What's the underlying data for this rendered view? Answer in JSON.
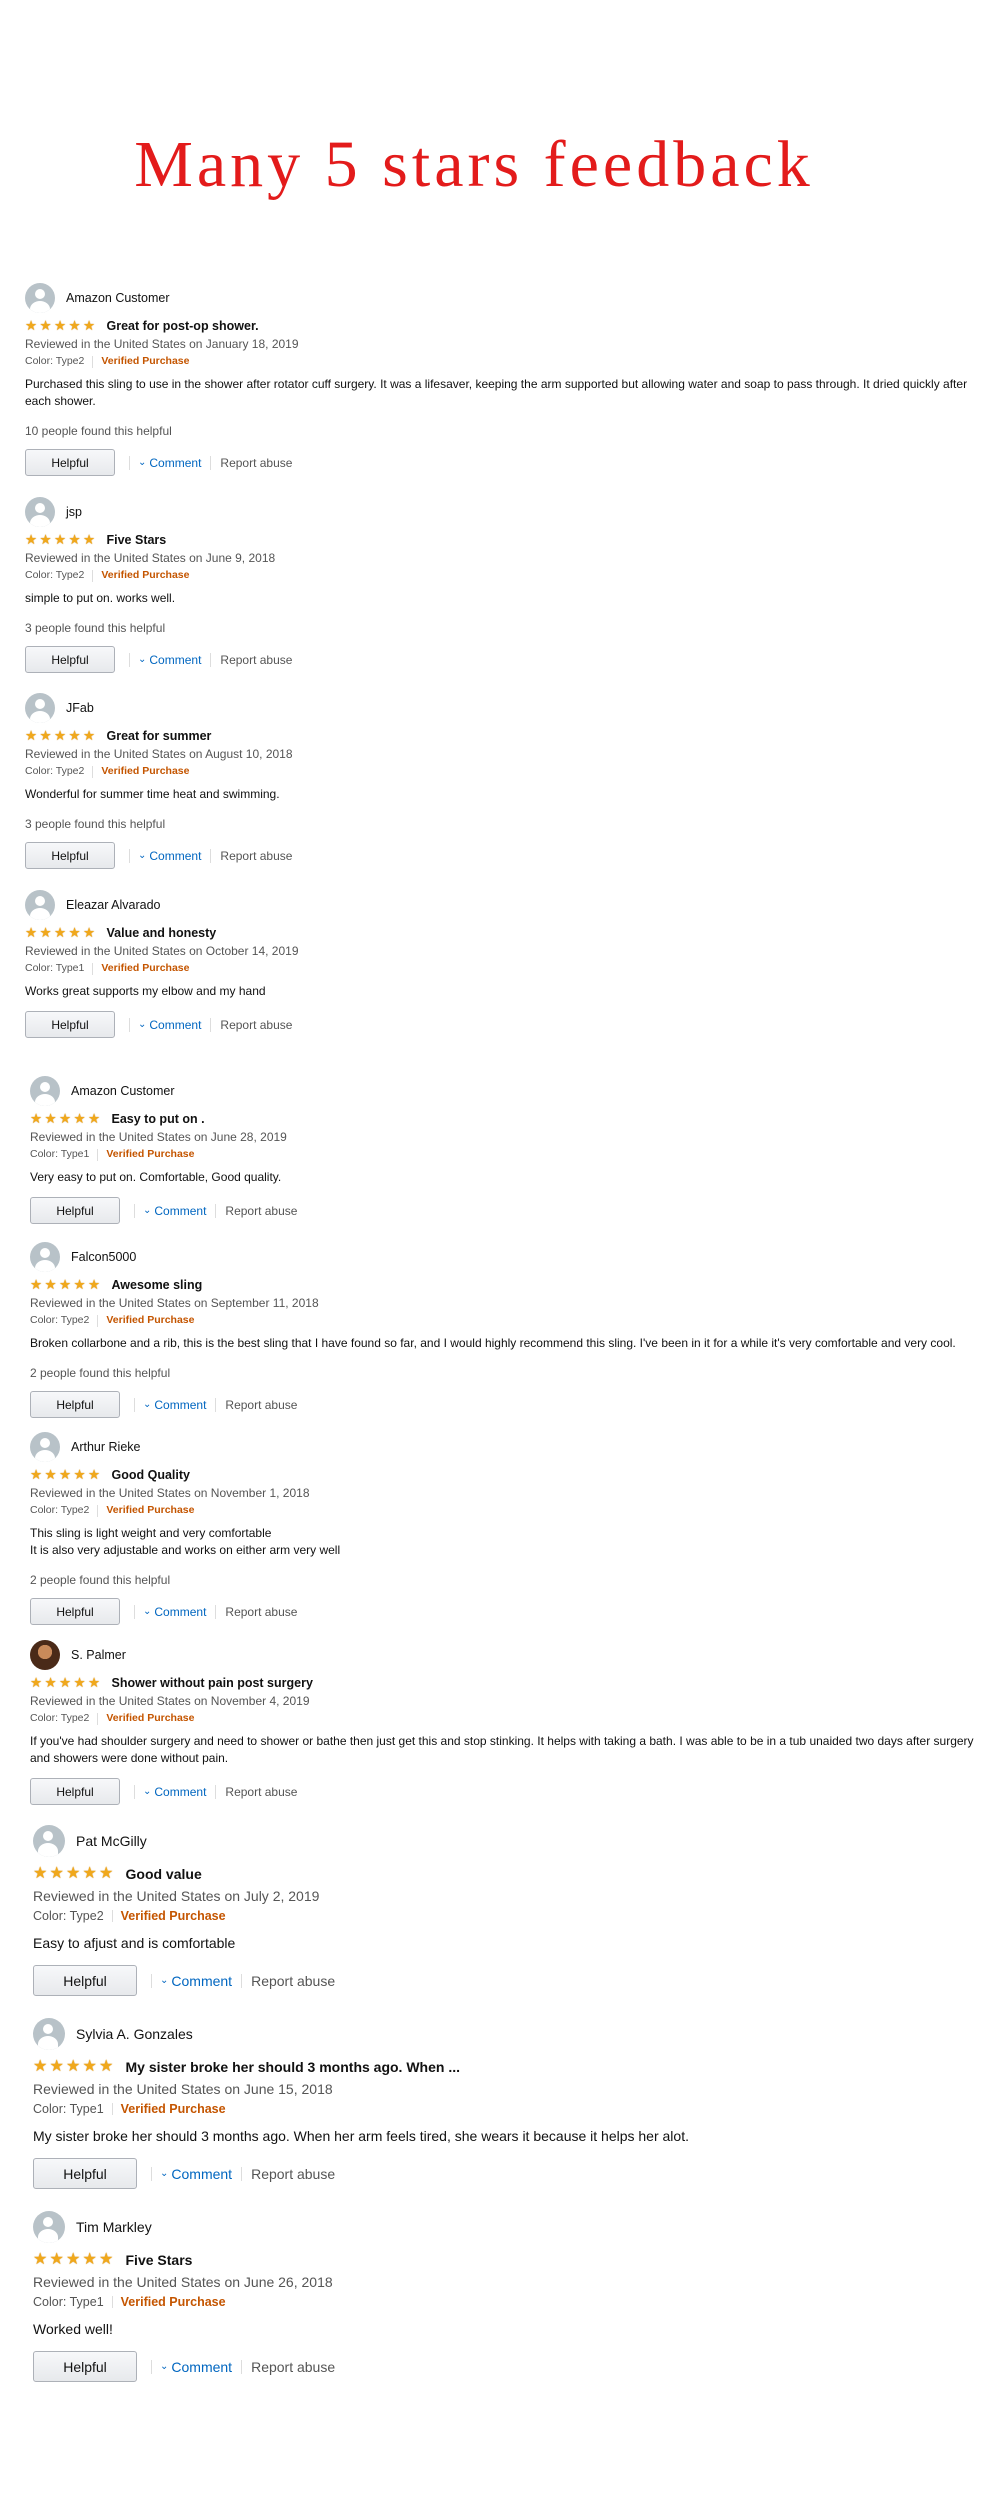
{
  "banner": "Many 5 stars feedback",
  "labels": {
    "verified": "Verified Purchase",
    "helpful_button": "Helpful",
    "comment": "Comment",
    "report": "Report abuse"
  },
  "reviews": [
    {
      "name": "Amazon Customer",
      "rating": 5,
      "title": "Great for post-op shower.",
      "date": "Reviewed in the United States on January 18, 2019",
      "color": "Color: Type2",
      "body": [
        "Purchased this sling to use in the shower after rotator cuff surgery. It was a lifesaver, keeping the arm supported but allowing water and soap to pass through. It dried quickly after each shower."
      ],
      "helpful": "10 people found this helpful",
      "avatar": "default"
    },
    {
      "name": "jsp",
      "rating": 5,
      "title": "Five Stars",
      "date": "Reviewed in the United States on June 9, 2018",
      "color": "Color: Type2",
      "body": [
        "simple to put on. works well."
      ],
      "helpful": "3 people found this helpful",
      "avatar": "default"
    },
    {
      "name": "JFab",
      "rating": 5,
      "title": "Great for summer",
      "date": "Reviewed in the United States on August 10, 2018",
      "color": "Color: Type2",
      "body": [
        "Wonderful for summer time heat and swimming."
      ],
      "helpful": "3 people found this helpful",
      "avatar": "default"
    },
    {
      "name": "Eleazar Alvarado",
      "rating": 5,
      "title": "Value and honesty",
      "date": "Reviewed in the United States on October 14, 2019",
      "color": "Color: Type1",
      "body": [
        "Works great supports my elbow and my hand"
      ],
      "helpful": "",
      "avatar": "default"
    },
    {
      "name": "Amazon Customer",
      "rating": 5,
      "title": "Easy to put on .",
      "date": "Reviewed in the United States on June 28, 2019",
      "color": "Color: Type1",
      "body": [
        "Very easy to put on. Comfortable, Good quality."
      ],
      "helpful": "",
      "avatar": "default"
    },
    {
      "name": "Falcon5000",
      "rating": 5,
      "title": "Awesome sling",
      "date": "Reviewed in the United States on September 11, 2018",
      "color": "Color: Type2",
      "body": [
        "Broken collarbone and a rib, this is the best sling that I have found so far, and I would highly recommend this sling. I've been in it for a while it's very comfortable and very cool."
      ],
      "helpful": "2 people found this helpful",
      "avatar": "default"
    },
    {
      "name": "Arthur Rieke",
      "rating": 5,
      "title": "Good Quality",
      "date": "Reviewed in the United States on November 1, 2018",
      "color": "Color: Type2",
      "body": [
        "This sling is light weight and very comfortable",
        "It is also very adjustable and works on either arm very well"
      ],
      "helpful": "2 people found this helpful",
      "avatar": "default"
    },
    {
      "name": "S. Palmer",
      "rating": 5,
      "title": "Shower without pain post surgery",
      "date": "Reviewed in the United States on November 4, 2019",
      "color": "Color: Type2",
      "body": [
        "If you've had shoulder surgery and need to shower or bathe then just get this and stop stinking. It helps with taking a bath. I was able to be in a tub unaided two days after surgery and showers were done without pain."
      ],
      "helpful": "",
      "avatar": "photo"
    },
    {
      "name": "Pat McGilly",
      "rating": 5,
      "title": "Good value",
      "date": "Reviewed in the United States on July 2, 2019",
      "color": "Color: Type2",
      "body": [
        "Easy to afjust and is comfortable"
      ],
      "helpful": "",
      "avatar": "default"
    },
    {
      "name": "Sylvia A. Gonzales",
      "rating": 5,
      "title": "My sister broke her should 3 months ago. When ...",
      "date": "Reviewed in the United States on June 15, 2018",
      "color": "Color: Type1",
      "body": [
        "My sister broke her should 3 months ago. When her arm feels tired, she wears it because it helps her alot."
      ],
      "helpful": "",
      "avatar": "default"
    },
    {
      "name": "Tim Markley",
      "rating": 5,
      "title": "Five Stars",
      "date": "Reviewed in the United States on June 26, 2018",
      "color": "Color: Type1",
      "body": [
        "Worked well!"
      ],
      "helpful": "",
      "avatar": "default"
    }
  ]
}
